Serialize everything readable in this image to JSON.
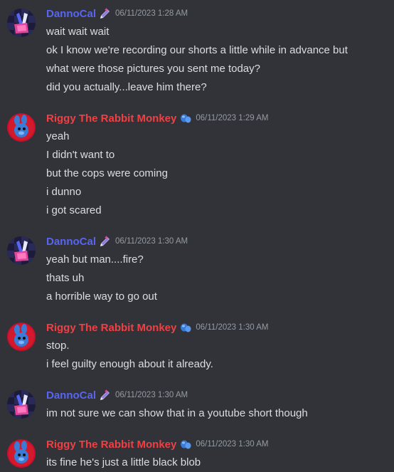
{
  "colors": {
    "background": "#313338",
    "danno": "#5865f2",
    "riggy": "#f23f43",
    "timestamp": "#949ba4",
    "text": "#dbdee1"
  },
  "messages": [
    {
      "author": "DannoCal",
      "badge": "pencil-bag-icon",
      "timestamp": "06/11/2023 1:28 AM",
      "lines": [
        "wait wait wait",
        "ok I know we're recording our shorts a little while in advance but",
        "what were those pictures you sent me today?",
        "did you actually...leave him there?"
      ]
    },
    {
      "author": "Riggy The Rabbit Monkey",
      "badge": "blue-glove-icon",
      "timestamp": "06/11/2023 1:29 AM",
      "lines": [
        "yeah",
        "I didn't want to",
        "but the cops were coming",
        "i dunno",
        "i got scared"
      ]
    },
    {
      "author": "DannoCal",
      "badge": "pencil-bag-icon",
      "timestamp": "06/11/2023 1:30 AM",
      "lines": [
        "yeah but man....fire?",
        "thats uh",
        "a horrible way to go out"
      ]
    },
    {
      "author": "Riggy The Rabbit Monkey",
      "badge": "blue-glove-icon",
      "timestamp": "06/11/2023 1:30 AM",
      "lines": [
        "stop.",
        "i feel guilty enough about it already."
      ]
    },
    {
      "author": "DannoCal",
      "badge": "pencil-bag-icon",
      "timestamp": "06/11/2023 1:30 AM",
      "lines": [
        "im not sure we can show that in a youtube short though"
      ]
    },
    {
      "author": "Riggy The Rabbit Monkey",
      "badge": "blue-glove-icon",
      "timestamp": "06/11/2023 1:30 AM",
      "lines": [
        "its fine he's just a little black blob"
      ]
    }
  ]
}
